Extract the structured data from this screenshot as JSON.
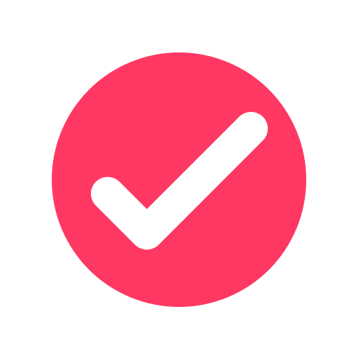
{
  "icon": {
    "name": "checkmark-circle-icon",
    "colors": {
      "background": "#ffffff",
      "circle": "#ff3863",
      "check": "#ffffff"
    }
  }
}
